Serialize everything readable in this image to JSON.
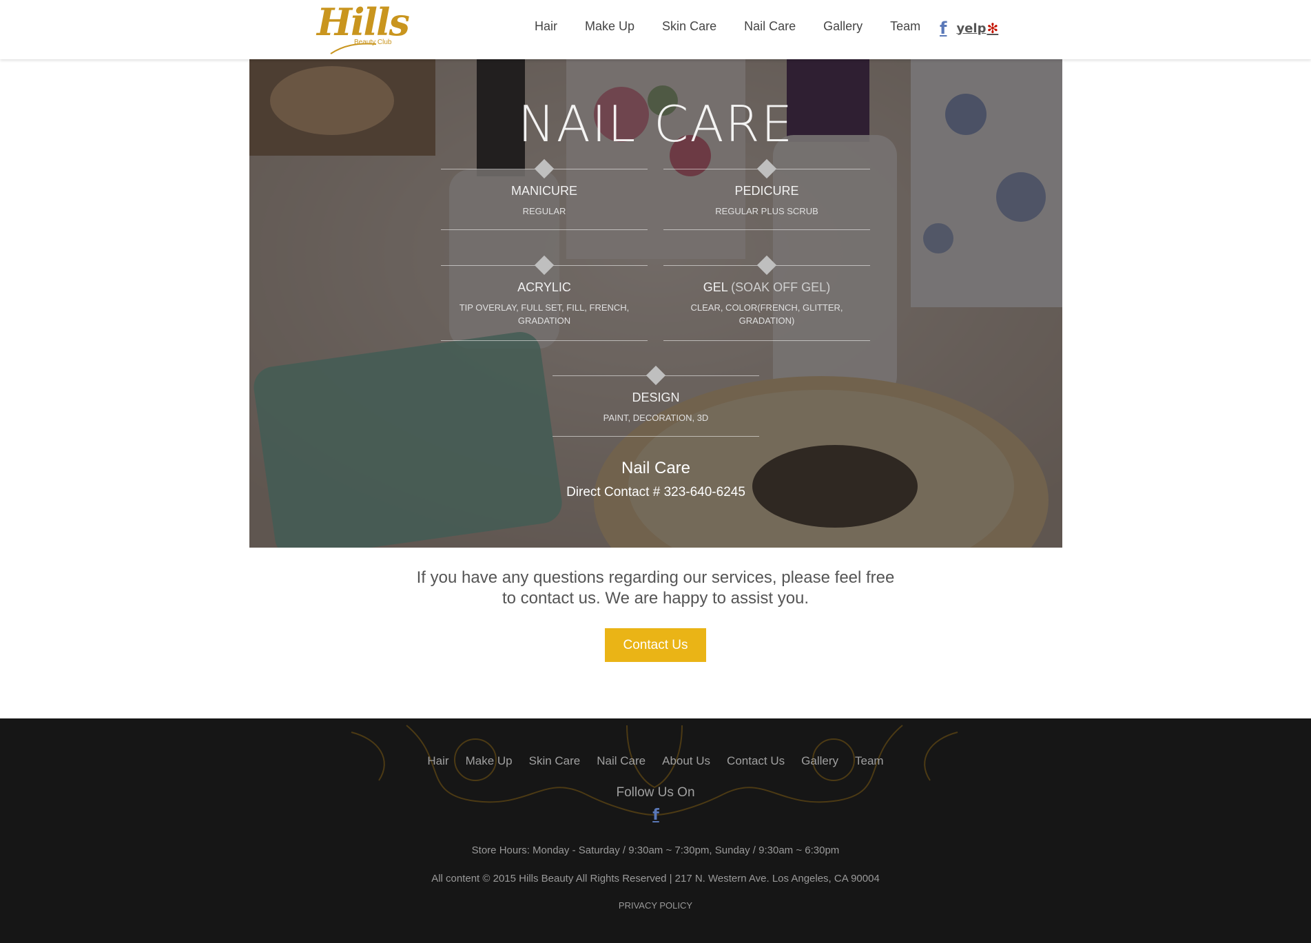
{
  "brand": {
    "logo_text": "Hills",
    "logo_sub": "Beauty Club"
  },
  "header": {
    "nav": [
      "Hair",
      "Make Up",
      "Skin Care",
      "Nail Care",
      "Gallery",
      "Team"
    ],
    "social": {
      "facebook": "f",
      "yelp": "yelp"
    }
  },
  "hero": {
    "title": "NAIL CARE",
    "services": [
      {
        "name": "MANICURE",
        "extra": "",
        "desc": "REGULAR"
      },
      {
        "name": "PEDICURE",
        "extra": "",
        "desc": "REGULAR PLUS SCRUB"
      },
      {
        "name": "ACRYLIC",
        "extra": "",
        "desc": "TIP OVERLAY, FULL SET, FILL, FRENCH, GRADATION"
      },
      {
        "name": "GEL",
        "extra": "(SOAK OFF GEL)",
        "desc": "CLEAR, COLOR(FRENCH, GLITTER, GRADATION)"
      },
      {
        "name": "DESIGN",
        "extra": "",
        "desc": "PAINT, DECORATION, 3D"
      }
    ],
    "heading": "Nail Care",
    "contact": "Direct Contact # 323-640-6245"
  },
  "cta": {
    "question_line1": "If you have any questions regarding our services, please feel free",
    "question_line2": "to contact us. We are happy to assist you.",
    "button": "Contact Us"
  },
  "footer": {
    "nav": [
      "Hair",
      "Make Up",
      "Skin Care",
      "Nail Care",
      "About Us",
      "Contact Us",
      "Gallery",
      "Team"
    ],
    "follow": "Follow Us On",
    "facebook": "f",
    "hours": "Store Hours: Monday - Saturday / 9:30am ~ 7:30pm, Sunday / 9:30am ~ 6:30pm",
    "copyright": "All content © 2015 Hills Beauty All Rights Reserved | 217 N. Western Ave. Los Angeles, CA 90004",
    "privacy": "PRIVACY POLICY"
  },
  "colors": {
    "accent": "#eab416",
    "logo": "#c9951e",
    "footer_bg": "#161616",
    "facebook": "#5a78b8",
    "yelp": "#c41200"
  }
}
